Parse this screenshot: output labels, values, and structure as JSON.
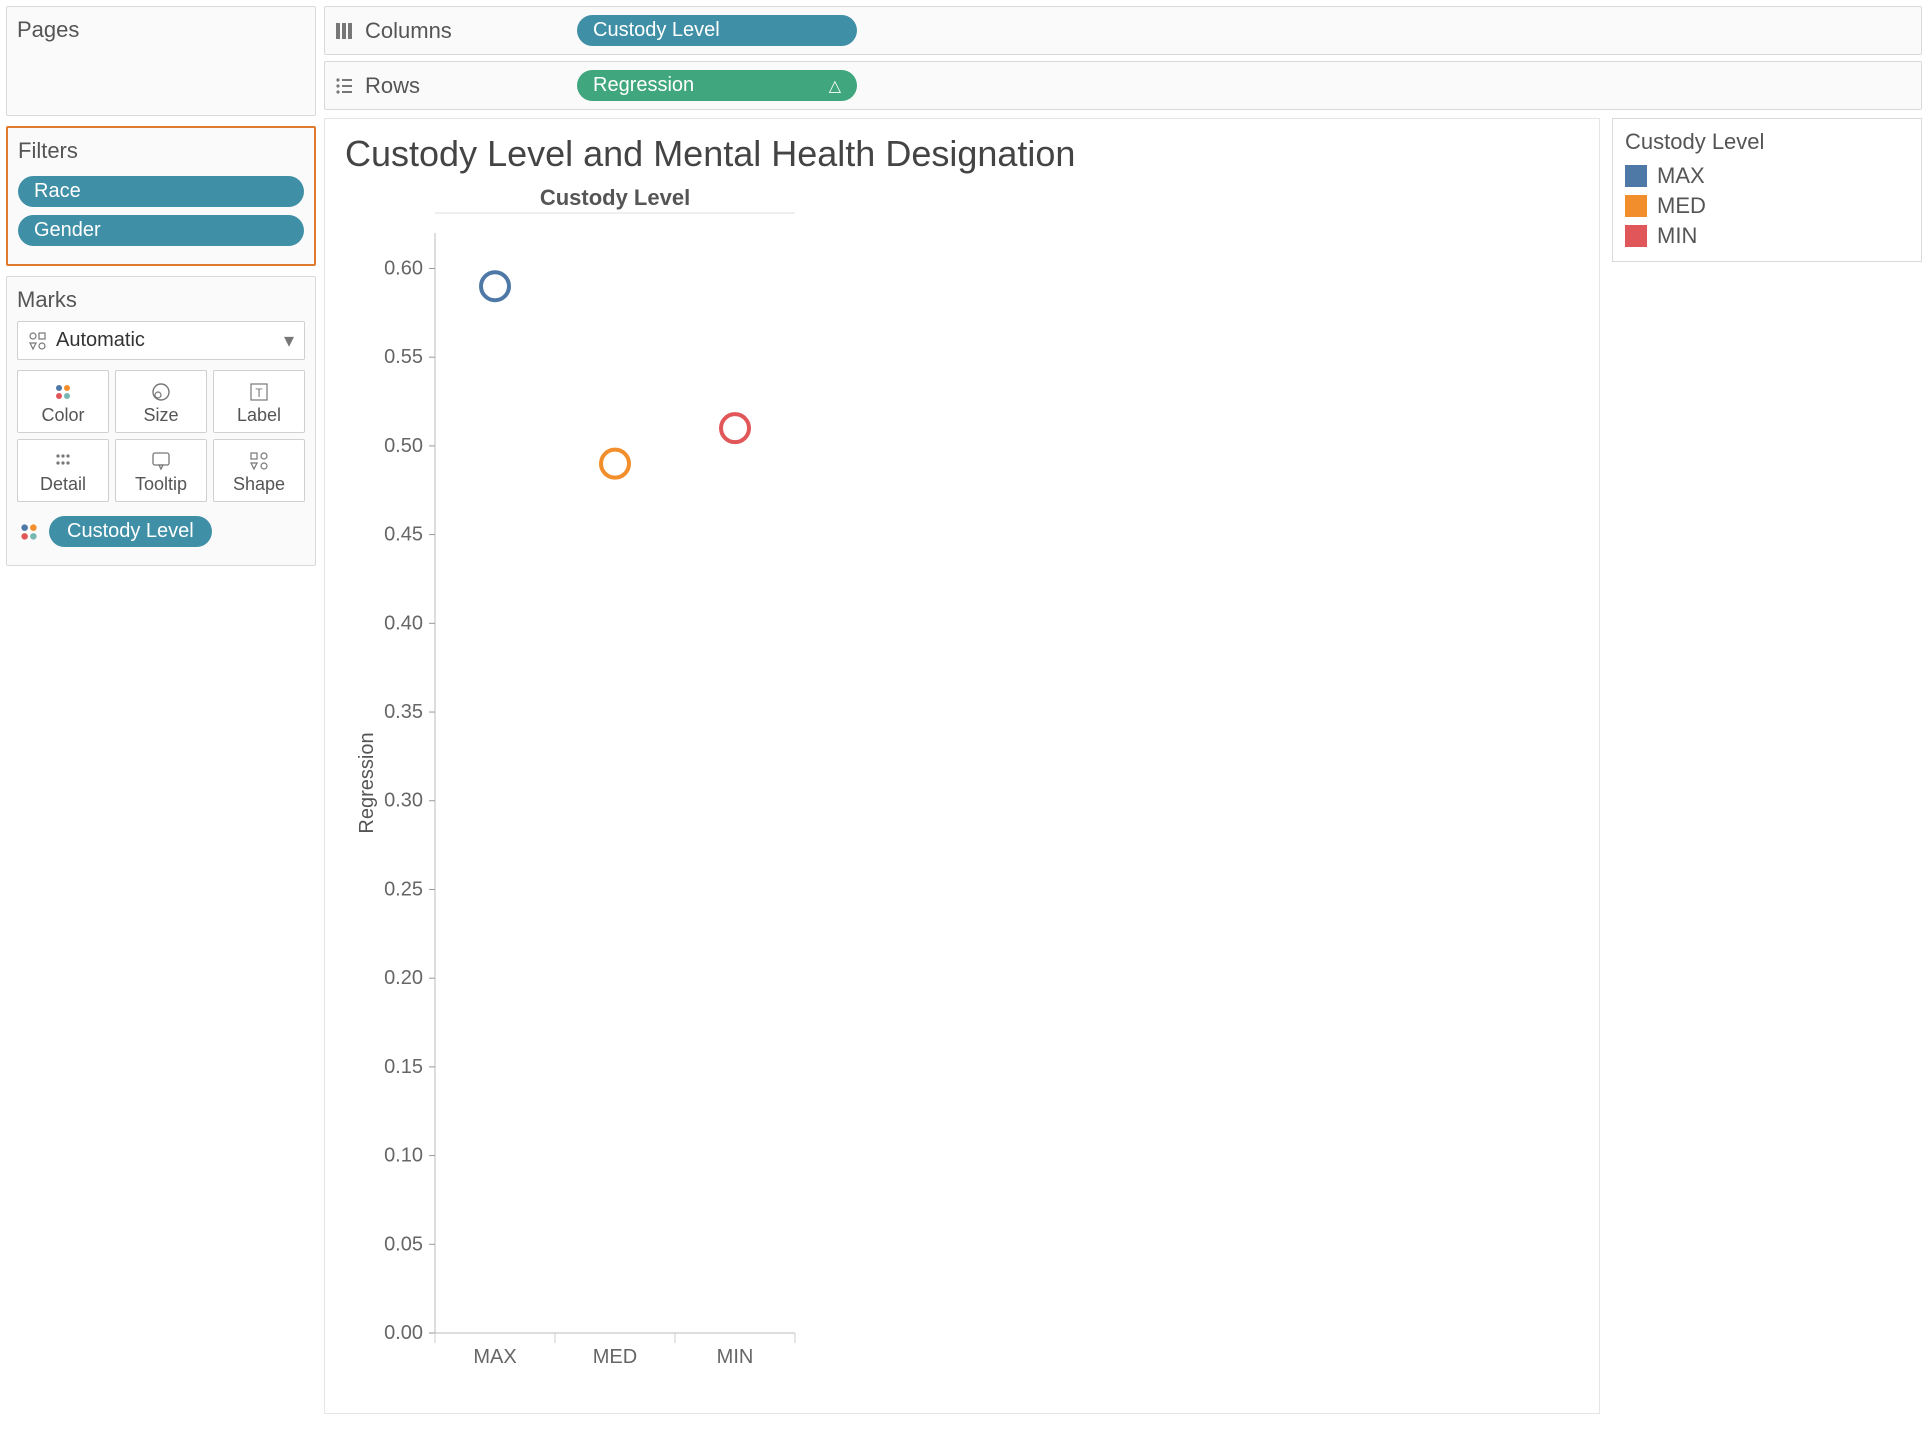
{
  "sidebar": {
    "pages_title": "Pages",
    "filters_title": "Filters",
    "filters": [
      {
        "label": "Race"
      },
      {
        "label": "Gender"
      }
    ],
    "marks_title": "Marks",
    "marks_type": "Automatic",
    "marks_cells": [
      {
        "label": "Color"
      },
      {
        "label": "Size"
      },
      {
        "label": "Label"
      },
      {
        "label": "Detail"
      },
      {
        "label": "Tooltip"
      },
      {
        "label": "Shape"
      }
    ],
    "mark_pill": "Custody Level"
  },
  "shelves": {
    "columns_label": "Columns",
    "columns_pill": "Custody Level",
    "rows_label": "Rows",
    "rows_pill": "Regression"
  },
  "viz": {
    "title": "Custody Level and Mental Health Designation",
    "column_header": "Custody Level",
    "ylabel": "Regression"
  },
  "legend": {
    "title": "Custody Level",
    "items": [
      {
        "label": "MAX",
        "color": "#4e79a7"
      },
      {
        "label": "MED",
        "color": "#f28e2b"
      },
      {
        "label": "MIN",
        "color": "#e15759"
      }
    ]
  },
  "chart_data": {
    "type": "scatter",
    "title": "Custody Level and Mental Health Designation",
    "xlabel": "Custody Level",
    "ylabel": "Regression",
    "categories": [
      "MAX",
      "MED",
      "MIN"
    ],
    "series": [
      {
        "name": "MAX",
        "color": "#4e79a7",
        "x": "MAX",
        "y": 0.59
      },
      {
        "name": "MED",
        "color": "#f28e2b",
        "x": "MED",
        "y": 0.49
      },
      {
        "name": "MIN",
        "color": "#e15759",
        "x": "MIN",
        "y": 0.51
      }
    ],
    "yticks": [
      0.0,
      0.05,
      0.1,
      0.15,
      0.2,
      0.25,
      0.3,
      0.35,
      0.4,
      0.45,
      0.5,
      0.55,
      0.6
    ],
    "ylim": [
      0.0,
      0.62
    ]
  }
}
